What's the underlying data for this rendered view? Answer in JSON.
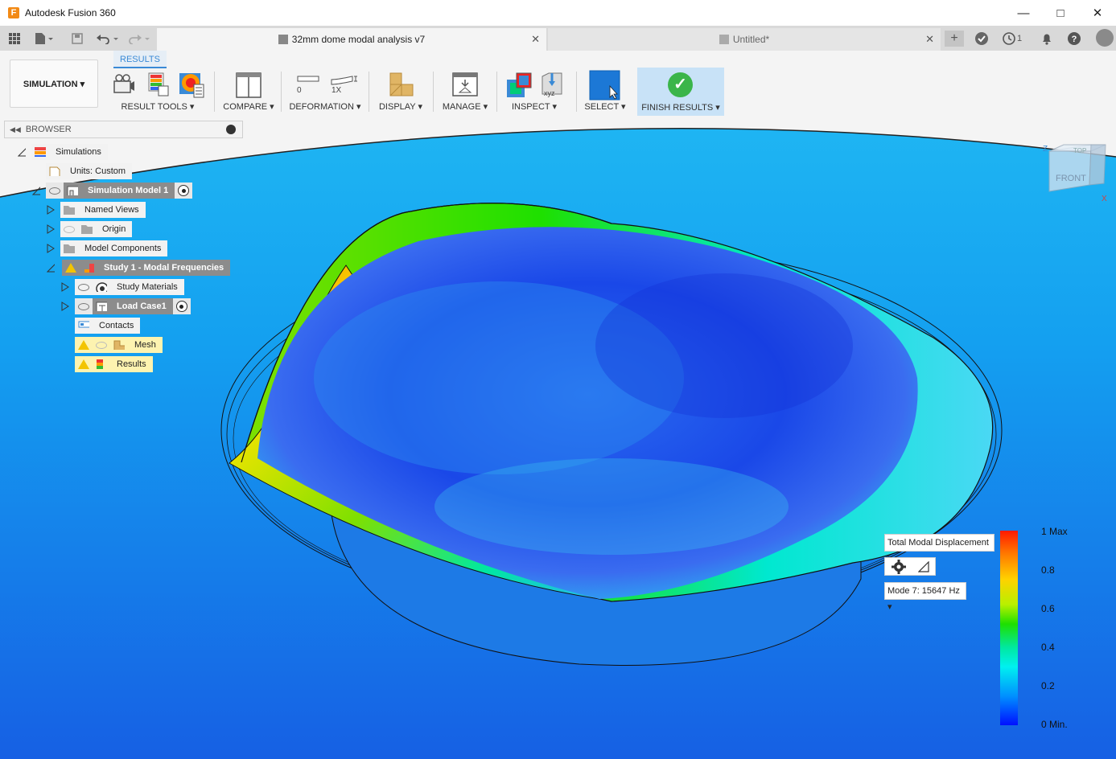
{
  "window": {
    "title": "Autodesk Fusion 360",
    "logo_letter": "F"
  },
  "tabs": [
    {
      "label": "32mm dome modal analysis v7",
      "active": true
    },
    {
      "label": "Untitled*",
      "active": false
    }
  ],
  "header": {
    "jobs_count": "1"
  },
  "workspace": {
    "label": "SIMULATION ▾",
    "tab": "RESULTS"
  },
  "toolbar": {
    "groups": [
      {
        "label": "RESULT TOOLS ▾"
      },
      {
        "label": "COMPARE ▾"
      },
      {
        "label": "DEFORMATION ▾",
        "deform_zero": "0",
        "deform_scale": "1X"
      },
      {
        "label": "DISPLAY ▾"
      },
      {
        "label": "MANAGE ▾"
      },
      {
        "label": "INSPECT ▾",
        "xyz": "xyz"
      },
      {
        "label": "SELECT ▾"
      },
      {
        "label": "FINISH RESULTS ▾"
      }
    ]
  },
  "browser": {
    "title": "BROWSER",
    "nodes": [
      {
        "label": "Simulations"
      },
      {
        "label": "Units: Custom"
      },
      {
        "label": "Simulation Model 1"
      },
      {
        "label": "Named Views"
      },
      {
        "label": "Origin"
      },
      {
        "label": "Model Components"
      },
      {
        "label": "Study 1 - Modal Frequencies"
      },
      {
        "label": "Study Materials"
      },
      {
        "label": "Load Case1"
      },
      {
        "label": "Contacts"
      },
      {
        "label": "Mesh"
      },
      {
        "label": "Results"
      }
    ]
  },
  "viewcube": {
    "top": "TOP",
    "front": "FRONT",
    "axis_z": "Z",
    "axis_x": "X"
  },
  "legend": {
    "result_type": "Total Modal Displacement ▾",
    "mode": "Mode 7: 15647 Hz ▾",
    "ticks": [
      "1 Max",
      "0.8",
      "0.6",
      "0.4",
      "0.2",
      "0 Min."
    ],
    "max_color": "#ff1a00",
    "min_color": "#0010ff"
  },
  "colors": {
    "accent": "#3a8ad6",
    "viewport_bg": "#1a6fe6",
    "finish_check": "#3bb54a"
  }
}
